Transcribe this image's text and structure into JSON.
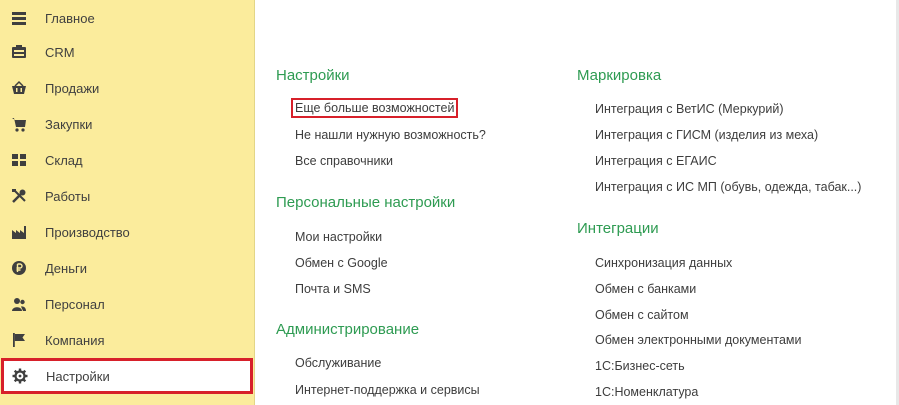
{
  "sidebar": {
    "items": [
      {
        "label": "Главное",
        "icon": "home-icon"
      },
      {
        "label": "CRM",
        "icon": "crm-icon"
      },
      {
        "label": "Продажи",
        "icon": "basket-icon"
      },
      {
        "label": "Закупки",
        "icon": "cart-icon"
      },
      {
        "label": "Склад",
        "icon": "warehouse-icon"
      },
      {
        "label": "Работы",
        "icon": "tools-icon"
      },
      {
        "label": "Производство",
        "icon": "factory-icon"
      },
      {
        "label": "Деньги",
        "icon": "ruble-icon"
      },
      {
        "label": "Персонал",
        "icon": "people-icon"
      },
      {
        "label": "Компания",
        "icon": "flag-icon"
      },
      {
        "label": "Настройки",
        "icon": "gear-icon"
      }
    ]
  },
  "main": {
    "left_column": [
      {
        "title": "Настройки",
        "links": [
          "Еще больше возможностей",
          "Не нашли нужную возможность?",
          "Все справочники"
        ]
      },
      {
        "title": "Персональные настройки",
        "links": [
          "Мои настройки",
          "Обмен с Google",
          "Почта и SMS"
        ]
      },
      {
        "title": "Администрирование",
        "links": [
          "Обслуживание",
          "Интернет-поддержка и сервисы"
        ]
      }
    ],
    "right_column": [
      {
        "title": "Маркировка",
        "links": [
          "Интеграция с ВетИС (Меркурий)",
          "Интеграция с ГИСМ (изделия из меха)",
          "Интеграция с ЕГАИС",
          "Интеграция с ИС МП (обувь, одежда, табак...)"
        ]
      },
      {
        "title": "Интеграции",
        "links": [
          "Синхронизация данных",
          "Обмен с банками",
          "Обмен с сайтом",
          "Обмен электронными документами",
          "1С:Бизнес-сеть",
          "1С:Номенклатура"
        ]
      }
    ]
  },
  "colors": {
    "sidebar_bg": "#fbec9c",
    "section_title": "#2e9b52",
    "highlight_border": "#d7202a"
  }
}
